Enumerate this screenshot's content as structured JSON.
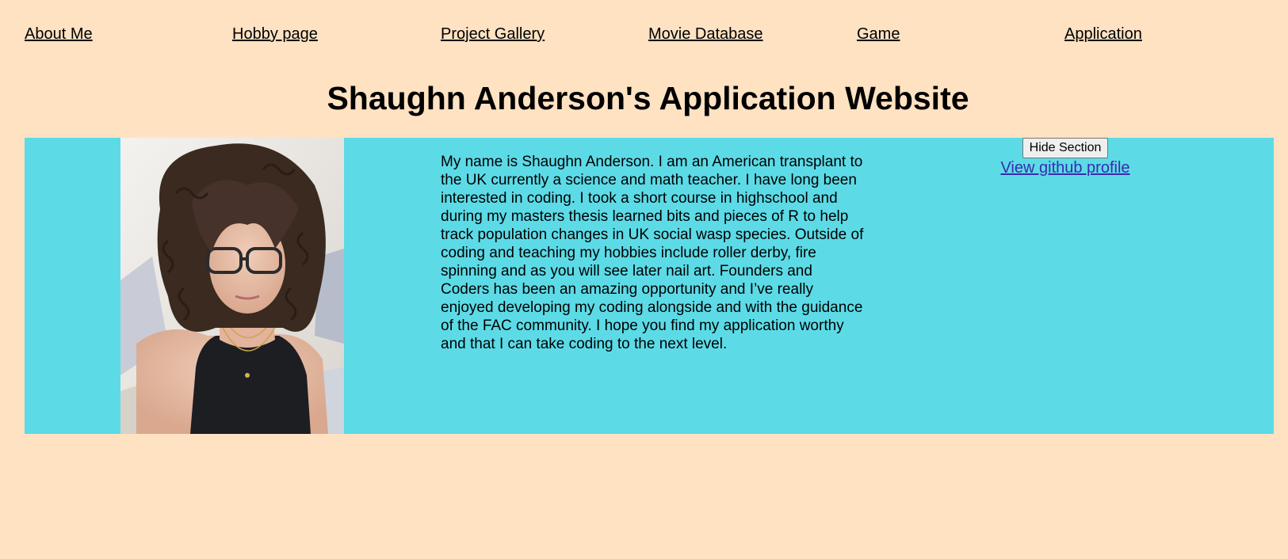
{
  "nav": {
    "items": [
      {
        "label": "About Me"
      },
      {
        "label": "Hobby page"
      },
      {
        "label": "Project Gallery"
      },
      {
        "label": "Movie Database"
      },
      {
        "label": "Game"
      },
      {
        "label": "Application"
      }
    ]
  },
  "header": {
    "title": "Shaughn Anderson's Application Website"
  },
  "about": {
    "bio": "My name is Shaughn Anderson. I am an American transplant to the UK currently a science and math teacher. I have long been interested in coding. I took a short course in highschool and during my masters thesis learned bits and pieces of R to help track population changes in UK social wasp species. Outside of coding and teaching my hobbies include roller derby, fire spinning and as you will see later nail art. Founders and Coders has been an amazing opportunity and I’ve really enjoyed developing my coding alongside and with the guidance of the FAC community. I hope you find my application worthy and that I can take coding to the next level.",
    "hide_button_label": "Hide Section",
    "github_link_label": "View github profile"
  },
  "colors": {
    "page_background": "#ffe2c2",
    "section_background": "#5cdbe7",
    "link_visited": "#3b2ab0"
  }
}
